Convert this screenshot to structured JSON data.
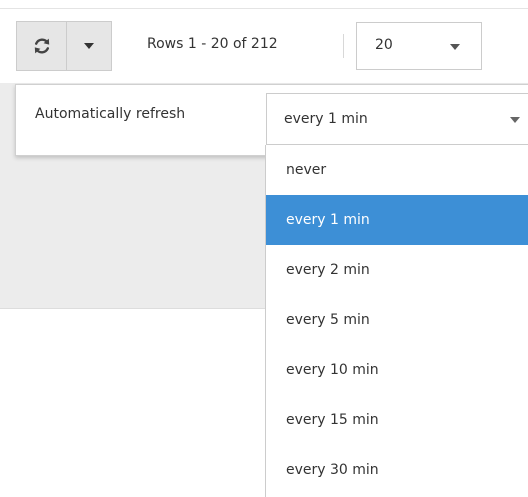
{
  "toolbar": {
    "refresh_icon": "refresh-icon",
    "dropdown_icon": "caret-down-icon",
    "rows_text": "Rows 1 - 20 of 212",
    "page_size": "20"
  },
  "auto_refresh": {
    "label": "Automatically refresh",
    "selected": "every 1 min",
    "options": [
      "never",
      "every 1 min",
      "every 2 min",
      "every 5 min",
      "every 10 min",
      "every 15 min",
      "every 30 min"
    ],
    "selected_index": 1
  },
  "colors": {
    "selected_bg": "#3d8fd6",
    "button_bg": "#e6e6e6",
    "panel_bg": "#ececec"
  }
}
